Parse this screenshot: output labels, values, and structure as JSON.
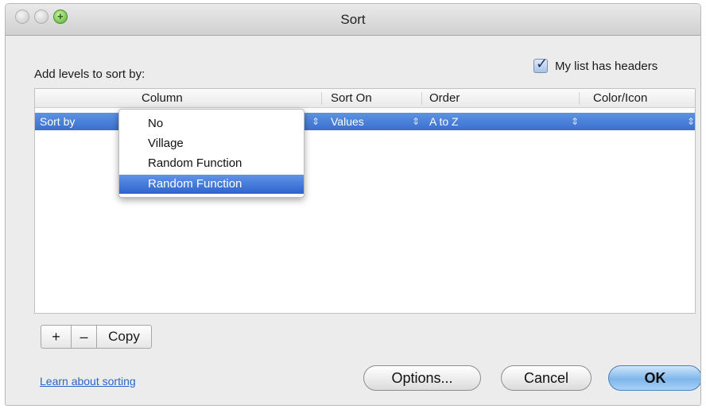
{
  "window": {
    "title": "Sort"
  },
  "header": {
    "add_levels_label": "Add levels to sort by:",
    "headers_checkbox_label": "My list has headers",
    "headers_checked": true
  },
  "table": {
    "columns": [
      "Column",
      "Sort On",
      "Order",
      "Color/Icon"
    ],
    "rows": [
      {
        "label": "Sort by",
        "sort_on": "Values",
        "order": "A to Z"
      }
    ]
  },
  "dropdown": {
    "options": [
      "No",
      "Village",
      "Random Function",
      "Random Function"
    ],
    "selected_index": 3
  },
  "level_buttons": {
    "add": "+",
    "remove": "–",
    "copy": "Copy"
  },
  "footer": {
    "learn_link": "Learn about sorting",
    "options_button": "Options...",
    "cancel_button": "Cancel",
    "ok_button": "OK"
  },
  "colors": {
    "selection": "#3b6fd0",
    "link": "#2a64c9"
  }
}
